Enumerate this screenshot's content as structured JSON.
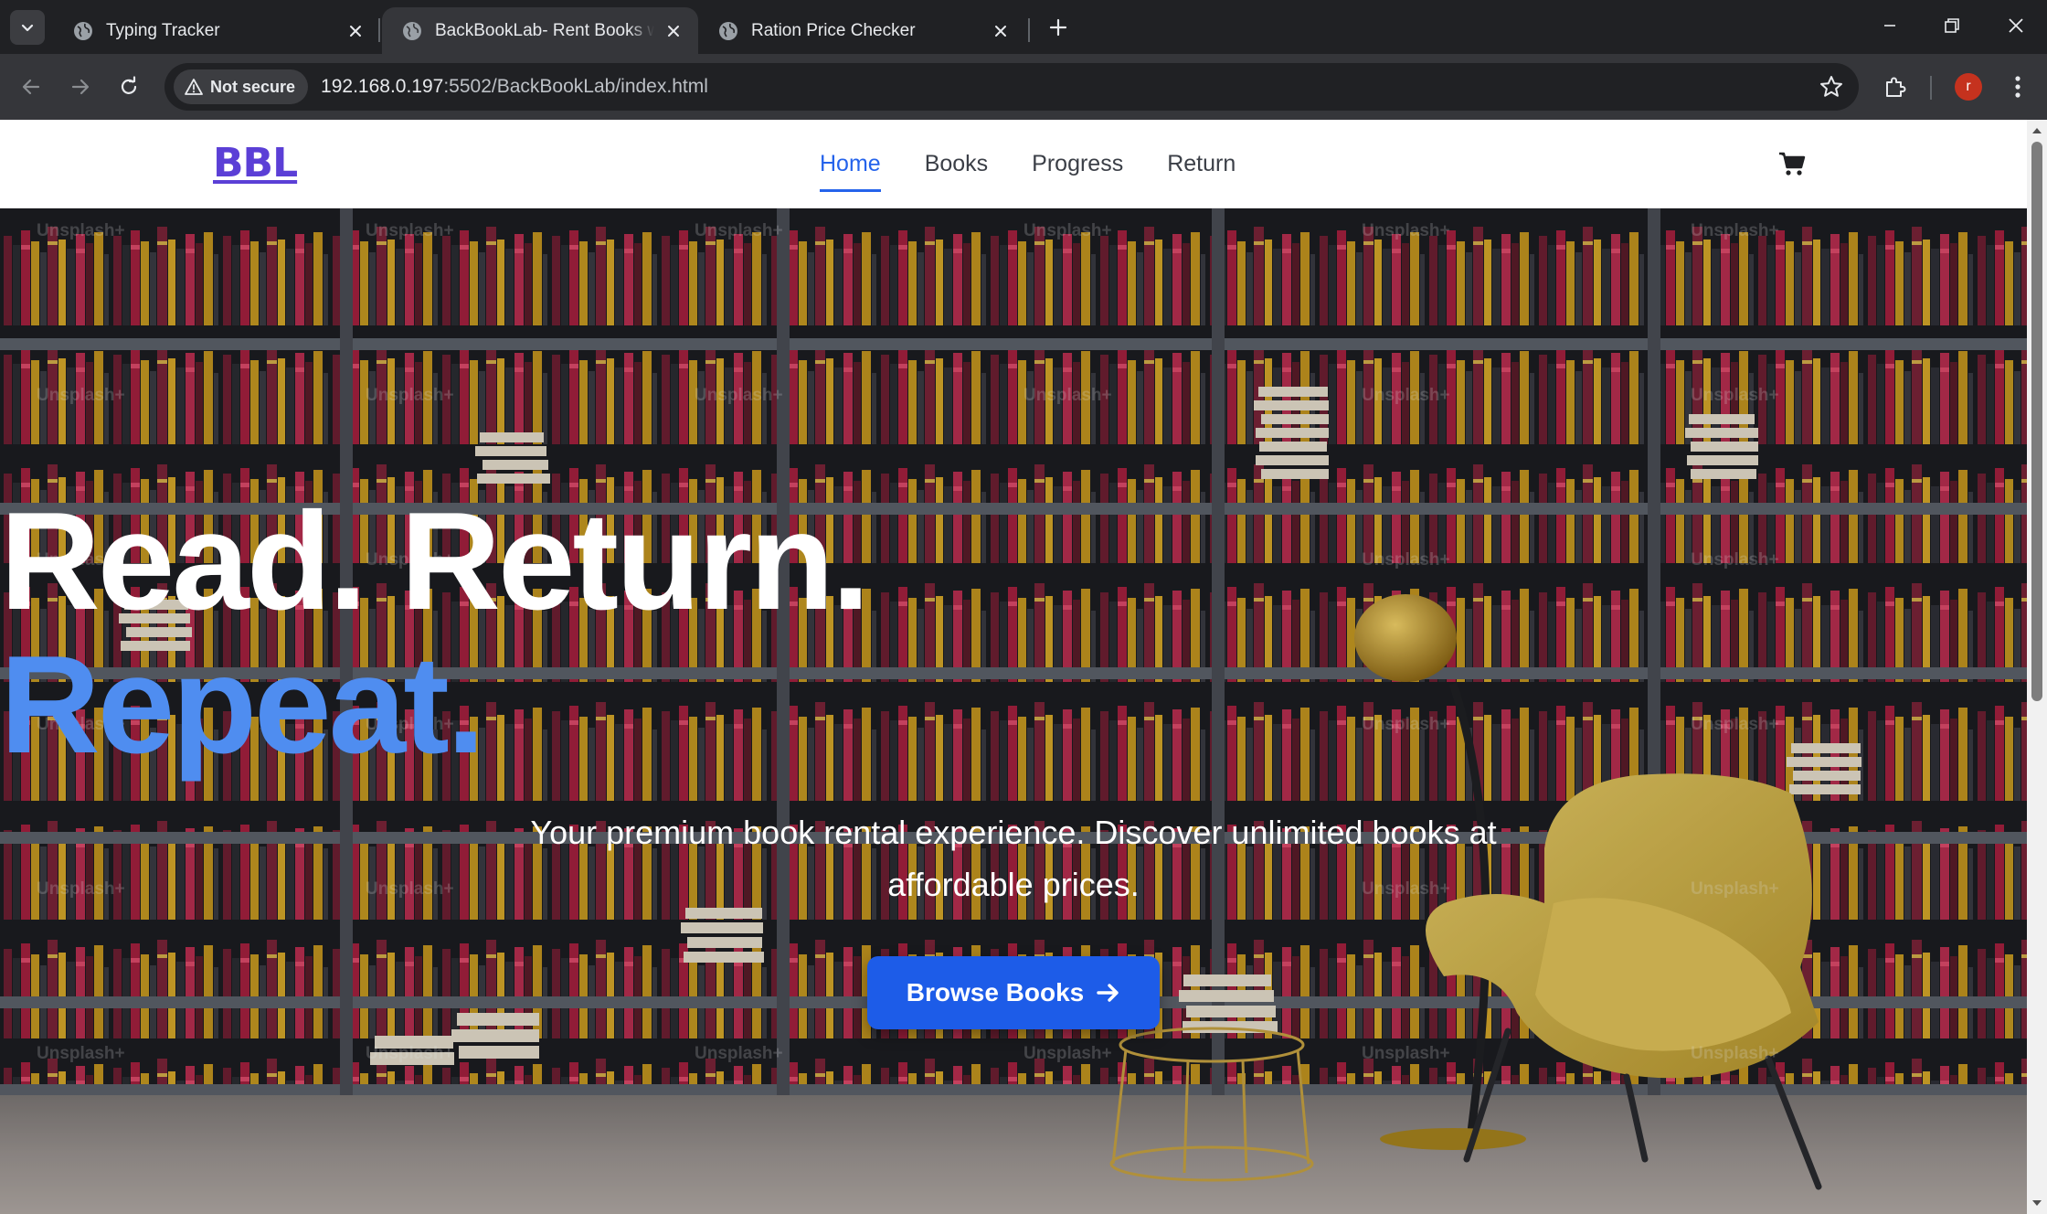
{
  "browser": {
    "tabs": [
      {
        "title": "Typing Tracker",
        "active": false
      },
      {
        "title": "BackBookLab- Rent Books with",
        "active": true
      },
      {
        "title": "Ration Price Checker",
        "active": false
      }
    ],
    "security_label": "Not secure",
    "url_host": "192.168.0.197",
    "url_rest": ":5502/BackBookLab/index.html",
    "profile_initial": "r"
  },
  "site": {
    "logo": "BBL",
    "nav": [
      {
        "label": "Home",
        "active": true
      },
      {
        "label": "Books",
        "active": false
      },
      {
        "label": "Progress",
        "active": false
      },
      {
        "label": "Return",
        "active": false
      }
    ],
    "hero": {
      "line1": "Read. Return.",
      "line2": "Repeat.",
      "subtitle": "Your premium book rental experience. Discover unlimited books at affordable prices.",
      "cta_label": "Browse Books"
    },
    "watermark_text": "Unsplash+"
  },
  "colors": {
    "accent_blue": "#2563eb",
    "hero_blue": "#4f8df0",
    "cta_blue": "#1d5ce8",
    "logo_purple": "#5b3fd6"
  }
}
